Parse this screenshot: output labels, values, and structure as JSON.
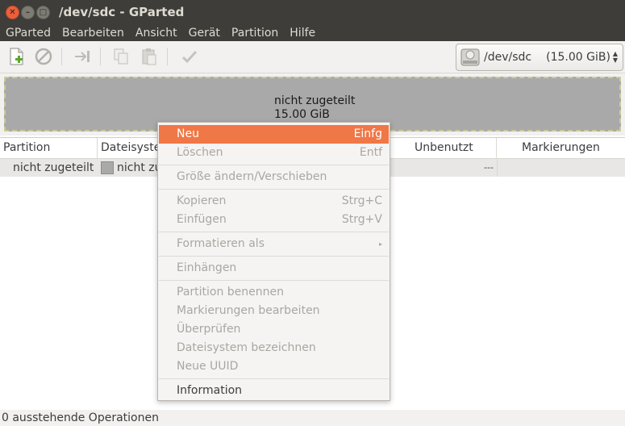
{
  "window": {
    "title": "/dev/sdc - GParted"
  },
  "menubar": {
    "items": [
      "GParted",
      "Bearbeiten",
      "Ansicht",
      "Gerät",
      "Partition",
      "Hilfe"
    ]
  },
  "toolbar": {
    "device": {
      "name": "/dev/sdc",
      "size": "(15.00 GiB)"
    }
  },
  "graph": {
    "label_line1": "nicht zugeteilt",
    "label_line2": "15.00 GiB",
    "color": "#a9a9a9"
  },
  "table": {
    "headers": [
      "Partition",
      "Dateisystem",
      "Unbenutzt",
      "Markierungen"
    ],
    "rows": [
      {
        "partition": "nicht zugeteilt",
        "filesystem": "nicht zugeteilt",
        "unused": "---",
        "flags": ""
      }
    ]
  },
  "context_menu": {
    "items": [
      {
        "label": "Neu",
        "accel": "Einfg"
      },
      {
        "label": "Löschen",
        "accel": "Entf"
      },
      {
        "label": "Größe ändern/Verschieben",
        "accel": ""
      },
      {
        "label": "Kopieren",
        "accel": "Strg+C"
      },
      {
        "label": "Einfügen",
        "accel": "Strg+V"
      },
      {
        "label": "Formatieren als",
        "accel": ""
      },
      {
        "label": "Einhängen",
        "accel": ""
      },
      {
        "label": "Partition benennen",
        "accel": ""
      },
      {
        "label": "Markierungen bearbeiten",
        "accel": ""
      },
      {
        "label": "Überprüfen",
        "accel": ""
      },
      {
        "label": "Dateisystem bezeichnen",
        "accel": ""
      },
      {
        "label": "Neue UUID",
        "accel": ""
      },
      {
        "label": "Information",
        "accel": ""
      }
    ],
    "highlight_color": "#f07746"
  },
  "statusbar": {
    "text": "0 ausstehende Operationen"
  }
}
